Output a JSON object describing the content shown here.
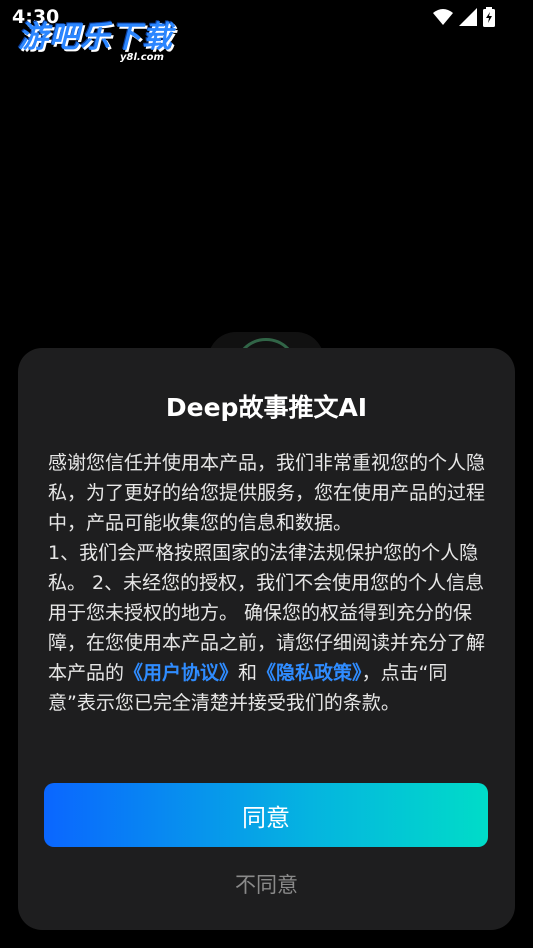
{
  "status_bar": {
    "time": "4:30",
    "icons": [
      "wifi-icon",
      "cellular-signal-icon",
      "battery-charging-icon"
    ]
  },
  "watermark": {
    "main": "游吧乐下载",
    "sub": "y8l.com"
  },
  "dialog": {
    "title": "Deep故事推文AI",
    "paragraph1": "感谢您信任并使用本产品，我们非常重视您的个人隐私，为了更好的给您提供服务，您在使用产品的过程中，产品可能收集您的信息和数据。",
    "paragraph2_text": "1、我们会严格按照国家的法律法规保护您的个人隐私。 2、未经您的授权，我们不会使用您的个人信息用于您未授权的地方。 确保您的权益得到充分的保障，在您使用本产品之前，请您仔细阅读并充分了解本产品的",
    "user_agreement_link": "《用户协议》",
    "and_text": "和",
    "privacy_policy_link": "《隐私政策》",
    "closing_text": "，点击“同意”表示您已完全清楚并接受我们的条款。",
    "agree_label": "同意",
    "disagree_label": "不同意"
  },
  "colors": {
    "background": "#000000",
    "dialog_bg": "#1e1e1f",
    "link": "#2f8cff",
    "button_gradient_start": "#0a66ff",
    "button_gradient_end": "#00dcc8",
    "disagree_text": "#8a8a8a"
  }
}
